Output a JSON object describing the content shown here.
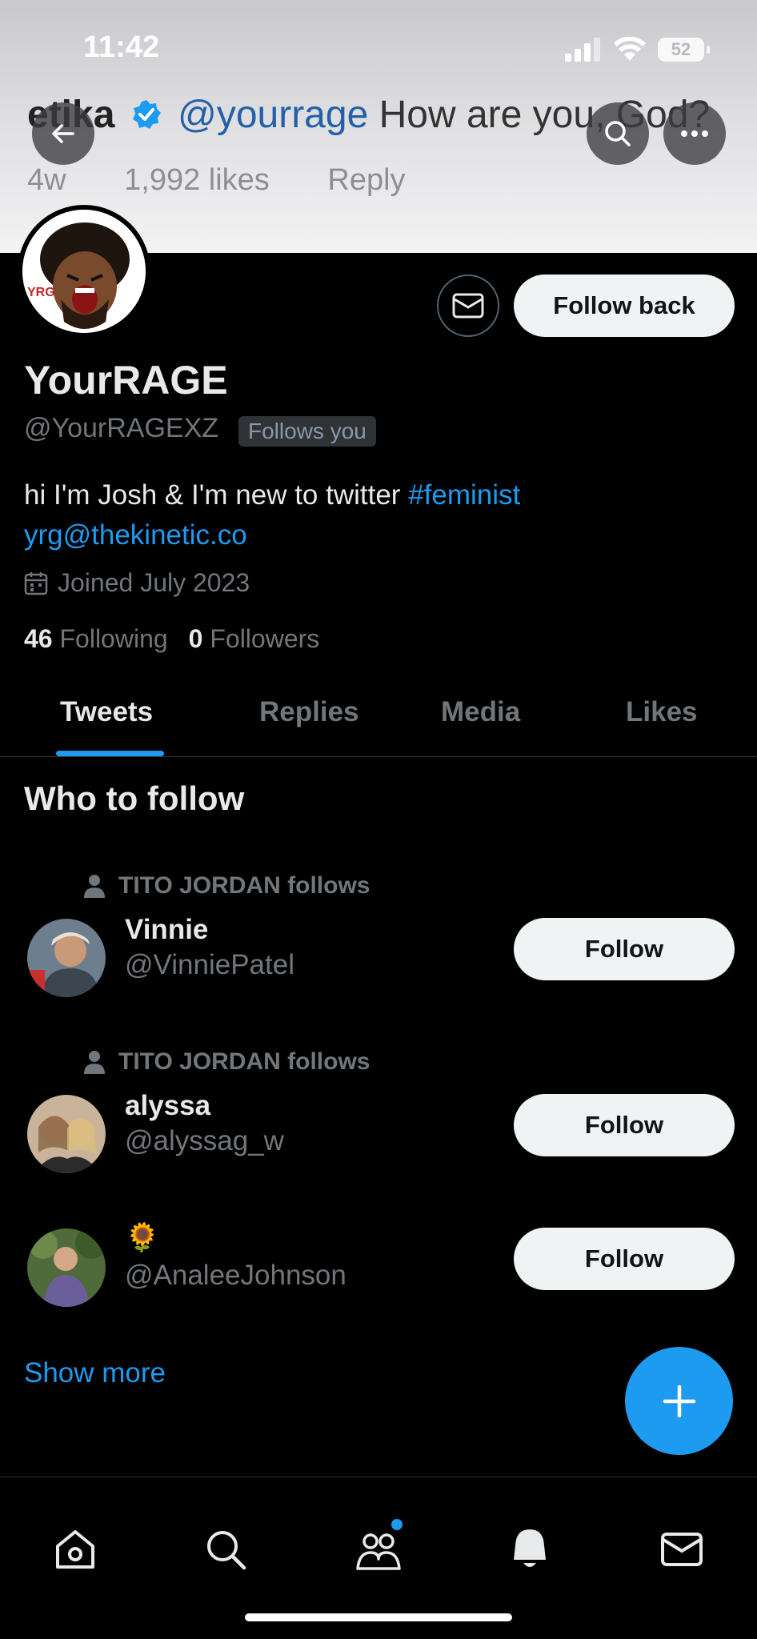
{
  "status_bar": {
    "time": "11:42",
    "battery": "52"
  },
  "background_tweet": {
    "user": "etika",
    "mention": "@yourrage",
    "text": "How are you, God?",
    "age": "4w",
    "likes": "1,992 likes",
    "reply": "Reply"
  },
  "profile": {
    "display_name": "YourRAGE",
    "handle": "@YourRAGEXZ",
    "follows_you": "Follows you",
    "follow_back_label": "Follow back",
    "bio_text": "hi I'm Josh & I'm new to twitter",
    "bio_hashtag": "#feminist",
    "bio_email": "yrg@thekinetic.co",
    "joined": "Joined July 2023",
    "following_count": "46",
    "following_label": "Following",
    "followers_count": "0",
    "followers_label": "Followers"
  },
  "tabs": [
    {
      "label": "Tweets",
      "active": true
    },
    {
      "label": "Replies",
      "active": false
    },
    {
      "label": "Media",
      "active": false
    },
    {
      "label": "Likes",
      "active": false
    }
  ],
  "who_to_follow": {
    "title": "Who to follow",
    "suggestions": [
      {
        "context": "TITO JORDAN follows",
        "name": "Vinnie",
        "handle": "@VinniePatel",
        "button": "Follow"
      },
      {
        "context": "TITO JORDAN follows",
        "name": "alyssa",
        "handle": "@alyssag_w",
        "button": "Follow"
      },
      {
        "context": "",
        "name": "🌻",
        "handle": "@AnaleeJohnson",
        "button": "Follow"
      }
    ],
    "show_more": "Show more"
  },
  "bottom_nav": [
    "home-icon",
    "search-icon",
    "communities-icon",
    "notifications-icon",
    "messages-icon"
  ],
  "colors": {
    "accent": "#1d9bf0",
    "background": "#000000",
    "muted": "#71767b"
  }
}
